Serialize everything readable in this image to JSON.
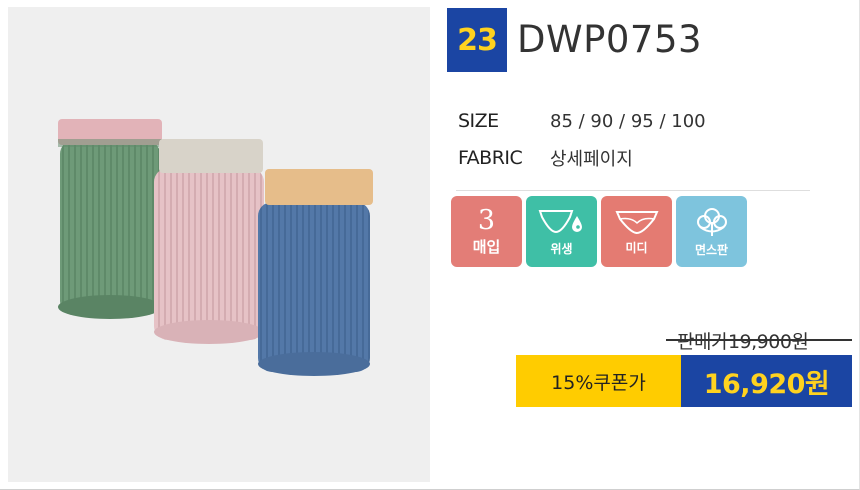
{
  "product": {
    "number": "23",
    "model": "DWP0753",
    "image_alt": "three folded ribbed panties in green, pink and blue"
  },
  "specs": [
    {
      "key": "SIZE",
      "value": "85 / 90 / 95 / 100"
    },
    {
      "key": "FABRIC",
      "value": "상세페이지"
    }
  ],
  "features": [
    {
      "big": "3",
      "label": "매입",
      "icon": "count-badge",
      "color": "#e37d77"
    },
    {
      "label": "위생",
      "icon": "hygiene-panty-drop-icon",
      "color": "#3fbfa6"
    },
    {
      "label": "미디",
      "icon": "midi-panty-icon",
      "color": "#e47b72"
    },
    {
      "label": "면스판",
      "icon": "cotton-flower-icon",
      "color": "#7ec4dd"
    }
  ],
  "pricing": {
    "list_price": "판매가19,900원",
    "coupon_label": "15%쿠폰가",
    "coupon_price": "16,920원",
    "accent_blue": "#1b45a3",
    "accent_yellow": "#ffcc00"
  }
}
